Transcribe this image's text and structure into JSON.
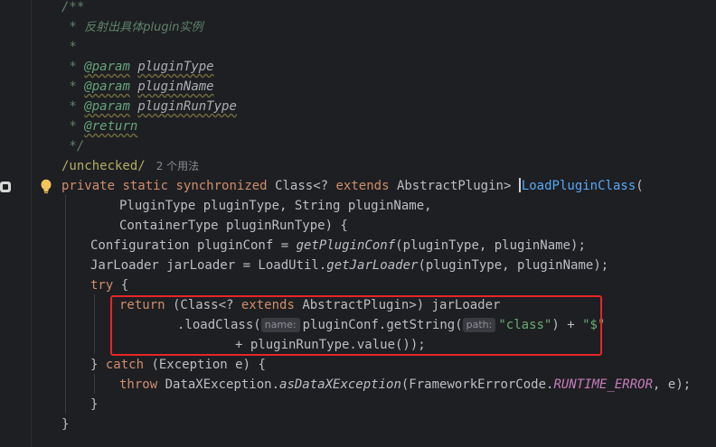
{
  "doc_comment": {
    "open": "/**",
    "desc_prefix": " * ",
    "desc": "反射出具体plugin实例",
    "blank": " *",
    "param_prefix": " * ",
    "param_tag": "@param",
    "params": [
      "pluginType",
      "pluginName",
      "pluginRunType"
    ],
    "return_tag": "@return",
    "close": " */"
  },
  "annotation": "/unchecked/",
  "usages": "2 个用法",
  "code": {
    "l1": {
      "private": "private",
      "static": "static",
      "synchronized": "synchronized",
      "class_type": "Class<? ",
      "extends": "extends",
      "abstract": " AbstractPlugin> ",
      "method": "LoadPluginClass",
      "open_paren": "("
    },
    "l2": "PluginType pluginType, String pluginName,",
    "l3": "ContainerType pluginRunType) {",
    "l4": {
      "a": "Configuration pluginConf = ",
      "call": "getPluginConf",
      "b": "(pluginType, pluginName);"
    },
    "l5": {
      "a": "JarLoader jarLoader = LoadUtil.",
      "call": "getJarLoader",
      "b": "(pluginType, pluginName);"
    },
    "l6": {
      "try": "try",
      "b": " {"
    },
    "l7": {
      "return": "return",
      "a": " (Class<? ",
      "extends": "extends",
      "b": " AbstractPlugin>) jarLoader"
    },
    "l8": {
      "a": ".loadClass(",
      "hint_name": "name:",
      "b": "pluginConf.getString(",
      "hint_path": "path:",
      "str_class": "\"class\"",
      "c": ") + ",
      "str_dollar": "\"$\""
    },
    "l9": "+ pluginRunType.value());",
    "l10": {
      "a": "} ",
      "catch": "catch",
      "b": " (Exception e) {"
    },
    "l11": {
      "throw": "throw",
      "a": " DataXException.",
      "call": "asDataXException",
      "b": "(FrameworkErrorCode.",
      "const": "RUNTIME_ERROR",
      "c": ", e);"
    },
    "l12": "}",
    "l13": "}"
  }
}
